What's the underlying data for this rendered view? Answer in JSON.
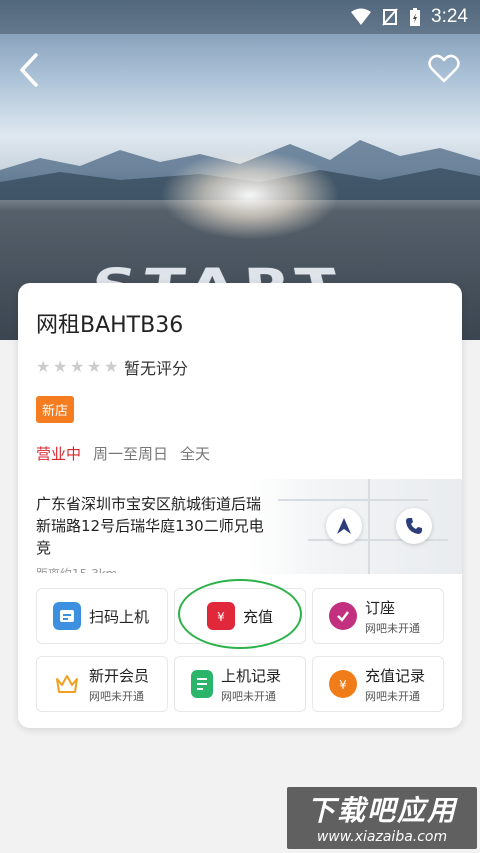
{
  "status_bar": {
    "time": "3:24"
  },
  "hero": {
    "road_text": "START"
  },
  "shop": {
    "name": "网租BAHTB36",
    "rating_text": "暂无评分",
    "badge": "新店",
    "status": "营业中",
    "days": "周一至周日",
    "hours": "全天",
    "address": "广东省深圳市宝安区航城街道后瑞新瑞路12号后瑞华庭130二师兄电竞",
    "distance": "距离约15.3km"
  },
  "actions": [
    {
      "label": "扫码上机",
      "sub": "",
      "icon": "scan-icon",
      "color": "#3d8fe0"
    },
    {
      "label": "充值",
      "sub": "",
      "icon": "wallet-icon",
      "color": "#e0283a"
    },
    {
      "label": "订座",
      "sub": "网吧未开通",
      "icon": "seat-icon",
      "color": "#c2307f"
    },
    {
      "label": "新开会员",
      "sub": "网吧未开通",
      "icon": "crown-icon",
      "color": "#f0a020"
    },
    {
      "label": "上机记录",
      "sub": "网吧未开通",
      "icon": "record-icon",
      "color": "#2bb56a"
    },
    {
      "label": "充值记录",
      "sub": "网吧未开通",
      "icon": "money-bag-icon",
      "color": "#f07d1a"
    }
  ],
  "watermark": {
    "main": "下载吧应用",
    "url": "www.xiazaiba.com"
  }
}
